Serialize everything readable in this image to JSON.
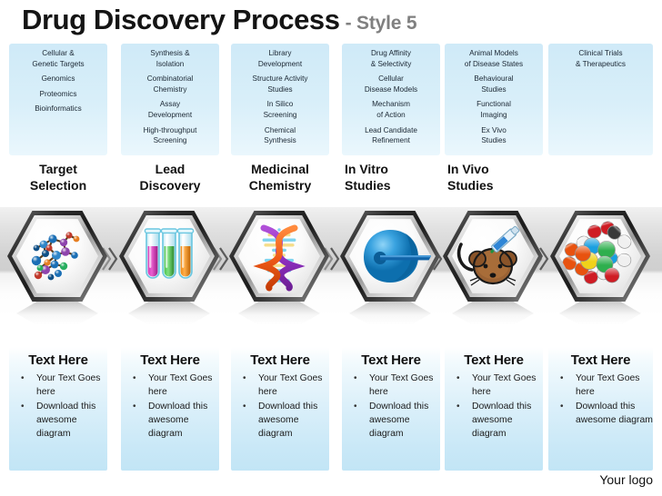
{
  "title": {
    "main": "Drug Discovery Process",
    "sub": "- Style 5"
  },
  "footer": {
    "logo": "Your logo"
  },
  "colors": {
    "panel_blue": "#cfeaf8",
    "panel_blue_light": "#eaf7fd",
    "title_dark": "#141414",
    "title_gray": "#808080",
    "band_gray": "#cfcfcf"
  },
  "columns": [
    {
      "stage_title": "Target\nSelection",
      "stage_title_l1": "Target",
      "stage_title_l2": "Selection",
      "icon": "molecule-icon",
      "top_groups": [
        [
          "Cellular &",
          "Genetic Targets"
        ],
        [
          "Genomics"
        ],
        [
          "Proteomics"
        ],
        [
          "Bioinformatics"
        ]
      ],
      "bottom": {
        "heading": "Text Here",
        "items": [
          "Your Text Goes here",
          "Download this awesome diagram"
        ]
      }
    },
    {
      "stage_title": "Lead\nDiscovery",
      "stage_title_l1": "Lead",
      "stage_title_l2": "Discovery",
      "icon": "test-tubes-icon",
      "top_groups": [
        [
          "Synthesis &",
          "Isolation"
        ],
        [
          "Combinatorial",
          "Chemistry"
        ],
        [
          "Assay",
          "Development"
        ],
        [
          "High-throughput",
          "Screening"
        ]
      ],
      "bottom": {
        "heading": "Text Here",
        "items": [
          "Your Text Goes here",
          "Download this awesome diagram"
        ]
      }
    },
    {
      "stage_title": "Medicinal\nChemistry",
      "stage_title_l1": "Medicinal",
      "stage_title_l2": "Chemistry",
      "icon": "dna-helix-icon",
      "top_groups": [
        [
          "Library",
          "Development"
        ],
        [
          "Structure Activity",
          "Studies"
        ],
        [
          "In Silico",
          "Screening"
        ],
        [
          "Chemical",
          "Synthesis"
        ]
      ],
      "bottom": {
        "heading": "Text Here",
        "items": [
          "Your Text Goes here",
          "Download this awesome diagram"
        ]
      }
    },
    {
      "stage_title": "In Vitro\nStudies",
      "stage_title_l1": "In Vitro",
      "stage_title_l2": "Studies",
      "icon": "cell-micropipette-icon",
      "top_groups": [
        [
          "Drug Affinity",
          "& Selectivity"
        ],
        [
          "Cellular",
          "Disease Models"
        ],
        [
          "Mechanism",
          "of Action"
        ],
        [
          "Lead Candidate",
          "Refinement"
        ]
      ],
      "bottom": {
        "heading": "Text Here",
        "items": [
          "Your Text Goes here",
          "Download this awesome diagram"
        ]
      }
    },
    {
      "stage_title": "In Vivo\nStudies",
      "stage_title_l1": "In Vivo",
      "stage_title_l2": "Studies",
      "icon": "lab-mouse-injection-icon",
      "top_groups": [
        [
          "Animal Models",
          "of Disease States"
        ],
        [
          "Behavioural",
          "Studies"
        ],
        [
          "Functional",
          "Imaging"
        ],
        [
          "Ex Vivo",
          "Studies"
        ]
      ],
      "bottom": {
        "heading": "Text Here",
        "items": [
          "Your Text Goes here",
          "Download this awesome diagram"
        ]
      }
    },
    {
      "stage_title": "",
      "stage_title_l1": "",
      "stage_title_l2": "",
      "icon": "pills-capsules-icon",
      "top_groups": [
        [
          "Clinical Trials",
          "& Therapeutics"
        ]
      ],
      "bottom": {
        "heading": "Text Here",
        "items": [
          "Your Text Goes here",
          "Download this awesome diagram"
        ]
      }
    }
  ]
}
